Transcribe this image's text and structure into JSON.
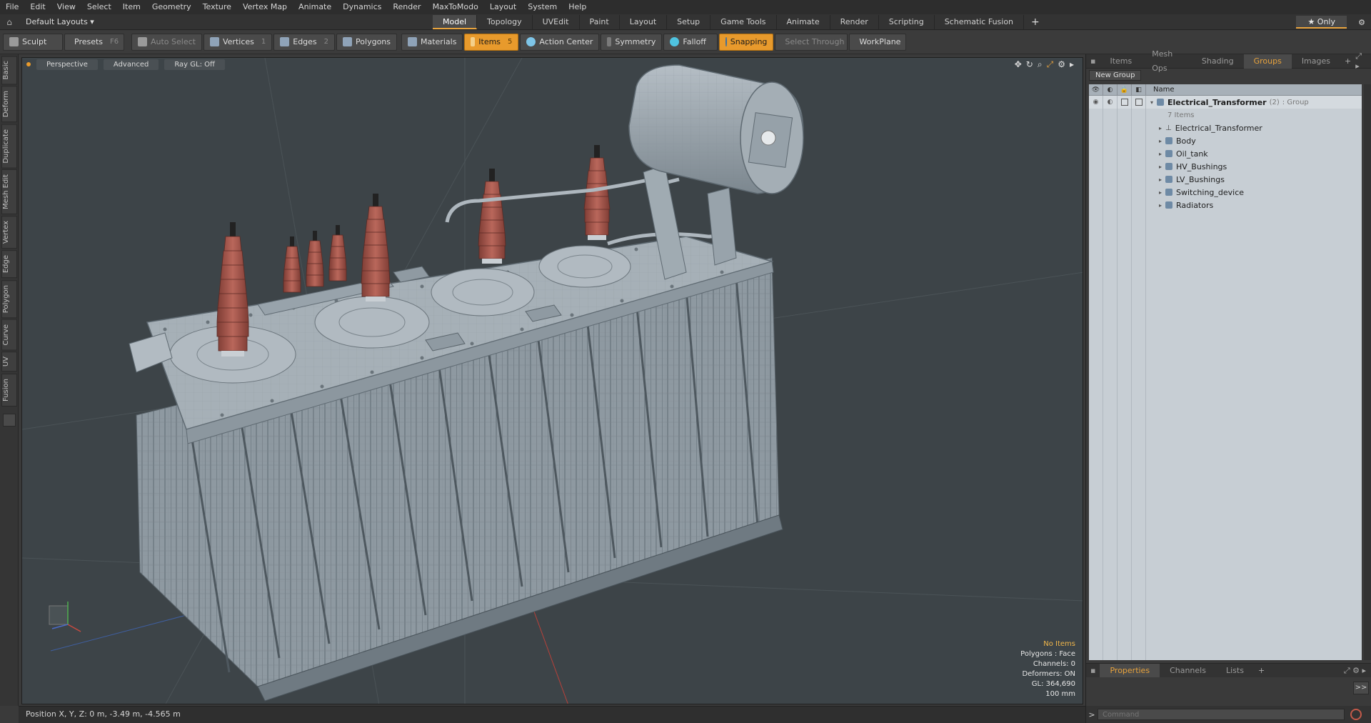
{
  "menu": [
    "File",
    "Edit",
    "View",
    "Select",
    "Item",
    "Geometry",
    "Texture",
    "Vertex Map",
    "Animate",
    "Dynamics",
    "Render",
    "MaxToModo",
    "Layout",
    "System",
    "Help"
  ],
  "layout": {
    "preset": "Default Layouts ▾",
    "tabs": [
      "Model",
      "Topology",
      "UVEdit",
      "Paint",
      "Layout",
      "Setup",
      "Game Tools",
      "Animate",
      "Render",
      "Scripting",
      "Schematic Fusion"
    ],
    "active_tab": "Model",
    "only_label": "★  Only"
  },
  "toolbar": {
    "sculpt": "Sculpt",
    "presets": "Presets",
    "presets_key": "F6",
    "auto_select": "Auto Select",
    "vertices": "Vertices",
    "vertices_key": "1",
    "edges": "Edges",
    "edges_key": "2",
    "polygons": "Polygons",
    "materials": "Materials",
    "items": "Items",
    "items_key": "5",
    "action_center": "Action Center",
    "symmetry": "Symmetry",
    "falloff": "Falloff",
    "snapping": "Snapping",
    "select_through": "Select Through",
    "workplane": "WorkPlane"
  },
  "left_tabs": [
    "Basic",
    "Deform",
    "Duplicate",
    "Mesh Edit",
    "Vertex",
    "Edge",
    "Polygon",
    "Curve",
    "UV",
    "Fusion"
  ],
  "viewport": {
    "view": "Perspective",
    "style": "Advanced",
    "raygl": "Ray GL: Off",
    "info": {
      "selection": "No Items",
      "polygons": "Polygons : Face",
      "channels": "Channels: 0",
      "deformers": "Deformers: ON",
      "gl": "GL: 364,690",
      "scale": "100 mm"
    }
  },
  "status": {
    "position": "Position X, Y, Z:  0 m, -3.49 m, -4.565 m"
  },
  "right_panel": {
    "tabs": [
      "Items",
      "Mesh Ops",
      "Shading",
      "Groups",
      "Images"
    ],
    "active_tab": "Groups",
    "new_group": "New Group",
    "column_name": "Name",
    "group": {
      "name": "Electrical_Transformer",
      "count": "(2)",
      "type": ": Group",
      "items_count": "7 Items"
    },
    "children": [
      "Electrical_Transformer",
      "Body",
      "Oil_tank",
      "HV_Bushings",
      "LV_Bushings",
      "Switching_device",
      "Radiators"
    ],
    "props_tabs": [
      "Properties",
      "Channels",
      "Lists"
    ],
    "props_active": "Properties",
    "command_placeholder": "Command"
  },
  "colors": {
    "accent": "#e8a33d",
    "viewport_bg": "#3d4448",
    "bushing": "#a4564c",
    "model_gray": "#9aa5ad"
  }
}
